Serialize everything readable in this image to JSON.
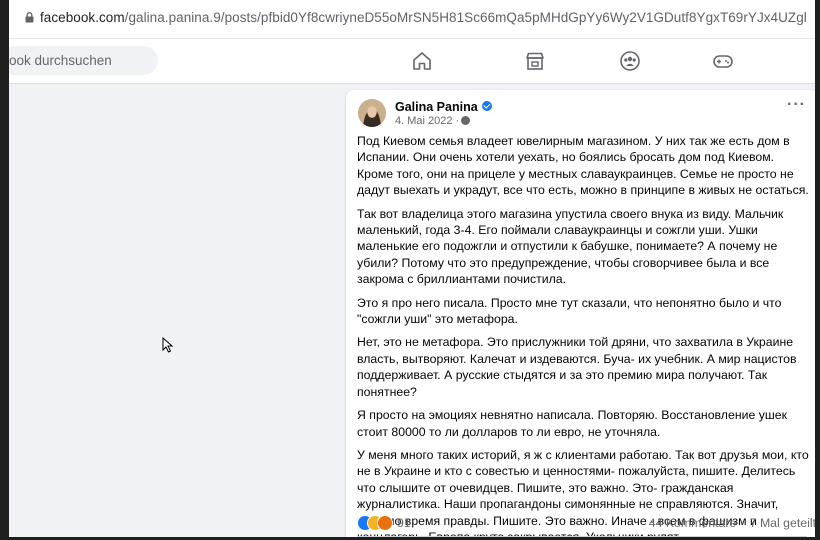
{
  "browser": {
    "url_main": "facebook.com",
    "url_rest": "/galina.panina.9/posts/pfbid0Yf8cwriyneD55oMrSN5H81Sc66mQa5pMHdGpYy6Wy2V1GDutf8YgxT69rYJx4UZgl"
  },
  "topbar": {
    "search_placeholder": "ook durchsuchen",
    "nav_icons": [
      "home-icon",
      "marketplace-icon",
      "groups-icon",
      "gaming-icon"
    ]
  },
  "post": {
    "author": "Galina Panina",
    "date": "4. Mai 2022 ·",
    "paragraphs": [
      "Под Киевом семья владеет ювелирным магазином. У них так же есть дом в Испании. Они очень хотели уехать, но боялись бросать дом под Киевом. Кроме того, они на прицеле у местных славаукраинцев. Семье не просто не дадут выехать и украдут, все что есть, можно в принципе в живых не остаться.",
      "Так вот владелица этого магазина упустила своего внука из виду. Мальчик маленький, года 3-4. Его поймали славаукраинцы и сожгли уши. Ушки маленькие его подожгли и отпустили к бабушке, понимаете? А почему не убили? Потому что это предупреждение, чтобы сговорчивее была и все закрома с бриллиантами почистила.",
      "Это я про него писала. Просто мне тут сказали, что непонятно было и что \"сожгли уши\" это метафора.",
      "Нет, это не метафора. Это прислужники той дряни, что захватила в Украине власть, вытворяют. Калечат и издеваются. Буча- их учебник. А мир нацистов поддерживает. А русские стыдятся и за это премию мира получают. Так понятнее?",
      "Я просто на эмоциях невнятно написала. Повторяю. Восстановление ушек стоит 80000 то ли долларов то ли евро, не уточняла.",
      "У меня много таких историй, я ж с клиентами работаю. Так вот друзья мои, кто не в Украине и кто с совестью и ценностями- пожалуйста, пишите. Делитесь что слышите от очевидцев. Пишите, это важно. Это- гражданская журналистика. Наши пропагандоны симонянные не справляются. Значит, пришло время правды. Пишите. Это важно. Иначе - всем в фашизм и концлагерь. Европа круто закрывается. Укольчики рулят."
    ],
    "reaction_count": "91",
    "comments": "44 Kommentare",
    "shares": "7 Mal geteilt",
    "more_label": "···"
  },
  "colors": {
    "accent": "#1877f2",
    "page_bg": "#f0f2f5",
    "text": "#050505",
    "muted": "#65676b"
  }
}
